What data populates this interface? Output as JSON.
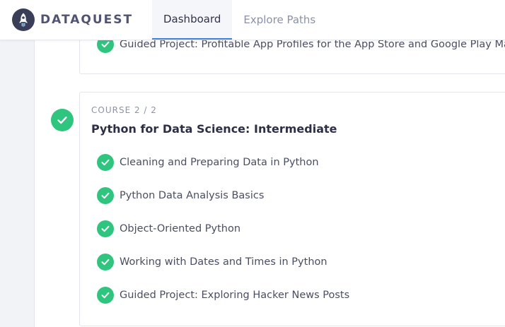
{
  "brand": {
    "name": "DATAQUEST",
    "logo_icon": "rocket-icon"
  },
  "nav": {
    "tabs": [
      {
        "label": "Dashboard",
        "active": true
      },
      {
        "label": "Explore Paths",
        "active": false
      }
    ]
  },
  "previous_course": {
    "lessons": [
      {
        "title": "Guided Project: Profitable App Profiles for the App Store and Google Play Markets",
        "status": "complete"
      }
    ]
  },
  "current_course": {
    "label": "COURSE 2 / 2",
    "title": "Python for Data Science: Intermediate",
    "status": "complete",
    "lessons": [
      {
        "title": "Cleaning and Preparing Data in Python",
        "status": "complete"
      },
      {
        "title": "Python Data Analysis Basics",
        "status": "complete"
      },
      {
        "title": "Object-Oriented Python",
        "status": "complete"
      },
      {
        "title": "Working with Dates and Times in Python",
        "status": "complete"
      },
      {
        "title": "Guided Project: Exploring Hacker News Posts",
        "status": "complete"
      }
    ]
  },
  "colors": {
    "accent_green": "#2fc57f",
    "active_tab_underline": "#3f82e0",
    "brand_dark": "#3b3e57"
  }
}
